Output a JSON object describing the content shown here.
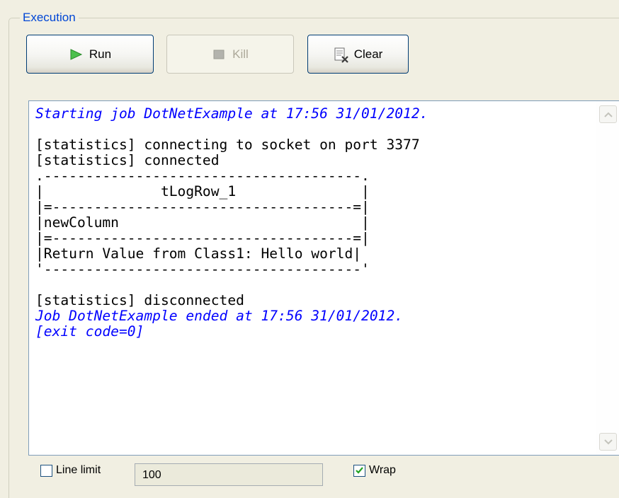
{
  "group": {
    "title": "Execution"
  },
  "toolbar": {
    "run_label": "Run",
    "kill_label": "Kill",
    "clear_label": "Clear"
  },
  "console": {
    "lines": [
      {
        "text": "Starting job DotNetExample at 17:56 31/01/2012.",
        "style": "info"
      },
      {
        "text": "",
        "style": "normal"
      },
      {
        "text": "[statistics] connecting to socket on port 3377",
        "style": "normal"
      },
      {
        "text": "[statistics] connected",
        "style": "normal"
      },
      {
        "text": ".--------------------------------------.",
        "style": "normal"
      },
      {
        "text": "|              tLogRow_1               |",
        "style": "normal"
      },
      {
        "text": "|=------------------------------------=|",
        "style": "normal"
      },
      {
        "text": "|newColumn                             |",
        "style": "normal"
      },
      {
        "text": "|=------------------------------------=|",
        "style": "normal"
      },
      {
        "text": "|Return Value from Class1: Hello world|",
        "style": "normal"
      },
      {
        "text": "'--------------------------------------'",
        "style": "normal"
      },
      {
        "text": "",
        "style": "normal"
      },
      {
        "text": "[statistics] disconnected",
        "style": "normal"
      },
      {
        "text": "Job DotNetExample ended at 17:56 31/01/2012.",
        "style": "info"
      },
      {
        "text": "[exit code=0]",
        "style": "info"
      }
    ]
  },
  "options": {
    "line_limit_label": "Line limit",
    "line_limit_checked": false,
    "line_limit_value": "100",
    "wrap_label": "Wrap",
    "wrap_checked": true
  },
  "colors": {
    "group_title": "#0046d5",
    "info_text": "#0000ff",
    "run_icon": "#2fa52f"
  }
}
